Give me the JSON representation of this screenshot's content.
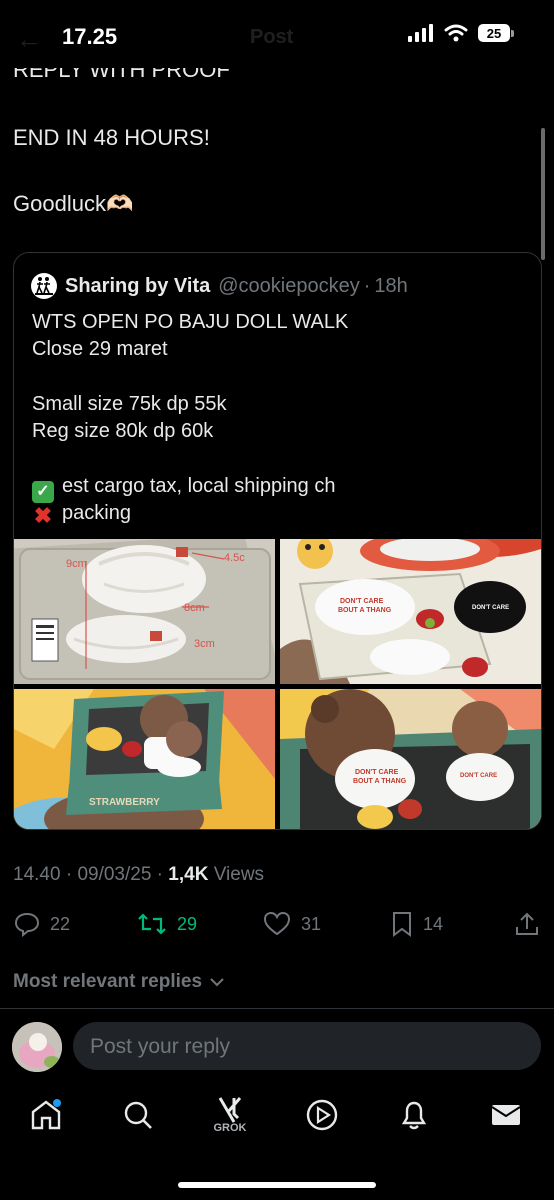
{
  "status_bar": {
    "time": "17.25",
    "battery": "25"
  },
  "header": {
    "title": "Post"
  },
  "post": {
    "line1": "REPLY WITH PROOF",
    "line2": "END IN 48 HOURS!",
    "line3": "Goodluck🫶🏻"
  },
  "quote": {
    "name": "Sharing by Vita",
    "handle": "@cookiepockey",
    "time": "18h",
    "lines": [
      "WTS OPEN PO BAJU DOLL WALK",
      "Close 29 maret",
      "Small size 75k dp 55k",
      "Reg size 80k dp 60k",
      "est cargo tax, local shipping ch",
      "packing"
    ],
    "photo_text": {
      "a": "9cm",
      "b": "4.5c",
      "c": "8cm",
      "d": "3cm",
      "e": "DON'T CARE",
      "f": "BOUT A THANG",
      "g": "STRAWBERRY"
    }
  },
  "meta": {
    "time": "14.40",
    "date": "09/03/25",
    "views_count": "1,4K",
    "views_label": "Views"
  },
  "actions": {
    "replies": "22",
    "reposts": "29",
    "likes": "31",
    "bookmarks": "14"
  },
  "replies_filter": {
    "label": "Most relevant replies"
  },
  "reply_bar": {
    "placeholder": "Post your reply"
  },
  "nav": {
    "grok_label": "GROK"
  },
  "colors": {
    "accent_blue": "#1d9bf0",
    "repost_green": "#00ba7c",
    "muted": "#71767b",
    "text": "#e7e9ea",
    "check_green": "#3aa84a",
    "cross_red": "#e0332b"
  }
}
